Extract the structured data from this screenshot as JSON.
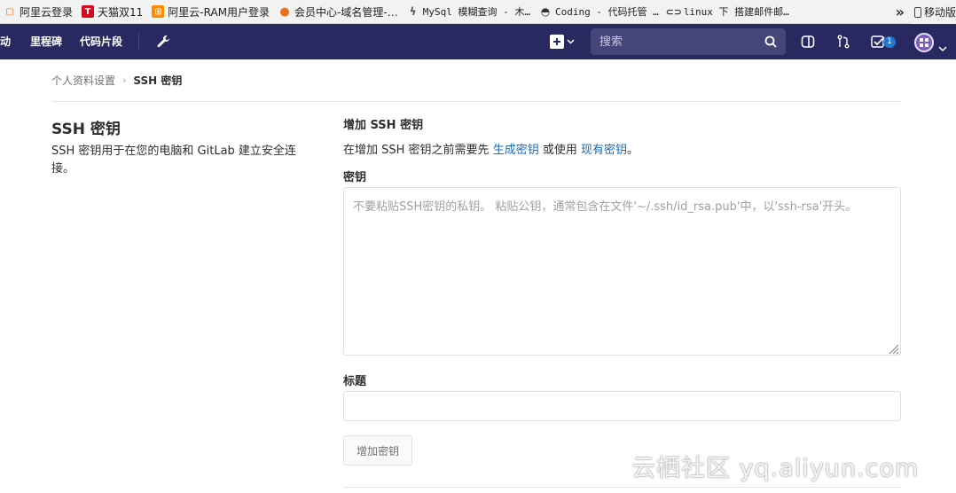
{
  "bookmarks": {
    "items": [
      {
        "label": "阿里云登录",
        "icon": "aliyun-icon",
        "mono": false
      },
      {
        "label": "天猫双11",
        "icon": "tmall-icon",
        "mono": false
      },
      {
        "label": "阿里云-RAM用户登录",
        "icon": "aliyun-ram-icon",
        "mono": false
      },
      {
        "label": "会员中心-域名管理-…",
        "icon": "fruit-icon",
        "mono": false
      },
      {
        "label": "MySql 模糊查询 - 木…",
        "icon": "mysql-icon",
        "mono": true
      },
      {
        "label": "Coding - 代码托管 …",
        "icon": "coding-icon",
        "mono": true
      },
      {
        "label": "linux 下 搭建邮件邮…",
        "icon": "link-icon",
        "mono": true
      }
    ],
    "more": "»",
    "mobile": "移动版"
  },
  "navbar": {
    "activity": "动",
    "milestones": "里程碑",
    "snippets": "代码片段",
    "search_placeholder": "搜索",
    "todo_count": "1",
    "bg_color": "#292961"
  },
  "breadcrumb": {
    "parent": "个人资料设置",
    "current": "SSH 密钥"
  },
  "sidebar": {
    "title": "SSH 密钥",
    "description": "SSH 密钥用于在您的电脑和 GitLab 建立安全连接。"
  },
  "form": {
    "section_title": "增加 SSH 密钥",
    "help_prefix": "在增加 SSH 密钥之前需要先 ",
    "help_link1": "生成密钥",
    "help_middle": " 或使用 ",
    "help_link2": "现有密钥",
    "help_suffix": "。",
    "key_label": "密钥",
    "key_placeholder": "不要粘贴SSH密钥的私钥。 粘贴公钥，通常包含在文件'~/.ssh/id_rsa.pub'中，以'ssh-rsa'开头。",
    "title_label": "标题",
    "title_value": "",
    "submit_label": "增加密钥"
  },
  "watermark": "云栖社区 yq.aliyun.com",
  "colors": {
    "link": "#1b69b6",
    "accent": "#1f78d1"
  }
}
